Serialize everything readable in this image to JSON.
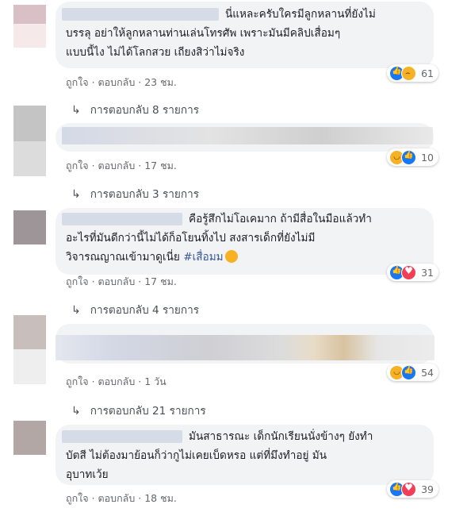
{
  "comments": [
    {
      "lines": [
        "นี่แหละครับใครมีลูกหลานที่ยังไม่",
        "บรรลุ อย่าให้ลูกหลานท่านเล่นโทรศัพ เพราะมันมีคลิปเสื่อมๆ",
        "แบบนี้ไง ไม่ได้โลกสวย เถียงสิว่าไม่จริง"
      ],
      "like_label": "ถูกใจ",
      "reply_label": "ตอบกลับ",
      "time": "23 ชม.",
      "reaction_icons": [
        "like-icon",
        "sad-icon"
      ],
      "reaction_count": "61",
      "replies_label": "การตอบกลับ 8 รายการ"
    },
    {
      "lines": [],
      "like_label": "ถูกใจ",
      "reply_label": "ตอบกลับ",
      "time": "17 ชม.",
      "reaction_icons": [
        "haha-icon",
        "like-icon"
      ],
      "reaction_count": "10",
      "replies_label": "การตอบกลับ 3 รายการ"
    },
    {
      "lines": [
        "คือรู้สึกไม่โอเคมาก ถ้ามีสื่อในมือแล้วทำ",
        "อะไรที่มันดีกว่านี้ไม่ได้ก็อโยนทิ้งไป สงสารเด็กที่ยังไม่มี",
        "วิจารณญาณเข้ามาดูเนี่ย "
      ],
      "hashtag": "#เสื่อมม",
      "like_label": "ถูกใจ",
      "reply_label": "ตอบกลับ",
      "time": "17 ชม.",
      "reaction_icons": [
        "like-icon",
        "love-icon"
      ],
      "reaction_count": "31",
      "replies_label": "การตอบกลับ 4 รายการ"
    },
    {
      "lines": [],
      "like_label": "ถูกใจ",
      "reply_label": "ตอบกลับ",
      "time": "1 วัน",
      "reaction_icons": [
        "haha-icon",
        "like-icon"
      ],
      "reaction_count": "54",
      "replies_label": "การตอบกลับ 21 รายการ"
    },
    {
      "lines": [
        "มันสาธารณะ เด็กนักเรียนนั่งข้างๆ ยังทำ",
        "บัตสี ไม่ต้องมาย้อนก็ว่ากูไม่เคยเบ็ดหรอ แต่ที่มึงทำอยู่ มัน",
        "อุบาทเว้ย"
      ],
      "like_label": "ถูกใจ",
      "reply_label": "ตอบกลับ",
      "time": "18 ชม.",
      "reaction_icons": [
        "like-icon",
        "love-icon"
      ],
      "reaction_count": "39"
    }
  ],
  "separator": "·"
}
